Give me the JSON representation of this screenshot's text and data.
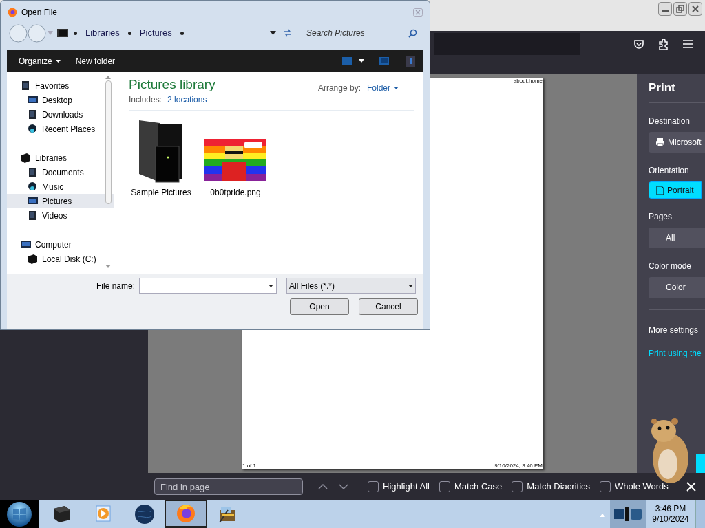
{
  "browser": {
    "print_preview": {
      "header": "about:home",
      "page_number": "1 of 1",
      "footer": "9/10/2024, 3:46 PM"
    },
    "print_panel": {
      "title": "Print",
      "sections": [
        {
          "label": "Destination",
          "value": "Microsoft",
          "kind": "printer",
          "selected": false
        },
        {
          "label": "Orientation",
          "value": "Portrait",
          "kind": "page",
          "selected": true
        },
        {
          "label": "Pages",
          "value": "All",
          "kind": "plain",
          "selected": false
        },
        {
          "label": "Color mode",
          "value": "Color",
          "kind": "plain",
          "selected": false
        }
      ],
      "more_settings": "More settings",
      "system_dialog_link": "Print using the"
    },
    "find_bar": {
      "placeholder": "Find in page",
      "options": [
        {
          "label": "Highlight All",
          "checked": false
        },
        {
          "label": "Match Case",
          "checked": false
        },
        {
          "label": "Match Diacritics",
          "checked": false
        },
        {
          "label": "Whole Words",
          "checked": false
        }
      ]
    }
  },
  "dialog": {
    "title": "Open File",
    "breadcrumb": [
      "Libraries",
      "Pictures"
    ],
    "search_placeholder": "Search Pictures",
    "toolbar": [
      {
        "label": "Organize",
        "dropdown": true
      },
      {
        "label": "New folder",
        "dropdown": false
      }
    ],
    "nav": [
      {
        "label": "Favorites",
        "kind": "tile",
        "selected": false,
        "children": [
          {
            "label": "Desktop",
            "kind": "monitor",
            "selected": false
          },
          {
            "label": "Downloads",
            "kind": "tile",
            "selected": false
          },
          {
            "label": "Recent Places",
            "kind": "sphere",
            "selected": false
          }
        ]
      },
      {
        "label": "Libraries",
        "kind": "box",
        "selected": false,
        "children": [
          {
            "label": "Documents",
            "kind": "tile",
            "selected": false
          },
          {
            "label": "Music",
            "kind": "sphere",
            "selected": false
          },
          {
            "label": "Pictures",
            "kind": "monitor",
            "selected": true
          },
          {
            "label": "Videos",
            "kind": "tile",
            "selected": false
          }
        ]
      },
      {
        "label": "Computer",
        "kind": "monitor",
        "selected": false,
        "children": [
          {
            "label": "Local Disk (C:)",
            "kind": "box",
            "selected": false
          }
        ]
      }
    ],
    "library_title": "Pictures library",
    "includes_label": "Includes:",
    "includes_link": "2 locations",
    "arrange_label": "Arrange by:",
    "arrange_value": "Folder",
    "files": [
      {
        "name": "Sample Pictures",
        "kind": "folder"
      },
      {
        "name": "0b0tpride.png",
        "kind": "image"
      }
    ],
    "file_name_label": "File name:",
    "file_type": "All Files (*.*)",
    "buttons": [
      "Open",
      "Cancel"
    ]
  },
  "taskbar": {
    "apps": [
      {
        "kind": "box",
        "selected": false
      },
      {
        "kind": "media",
        "selected": false
      },
      {
        "kind": "globe",
        "selected": false
      },
      {
        "kind": "firefox",
        "selected": true
      },
      {
        "kind": "archive",
        "selected": false
      }
    ],
    "time": "3:46 PM",
    "date": "9/10/2024"
  }
}
